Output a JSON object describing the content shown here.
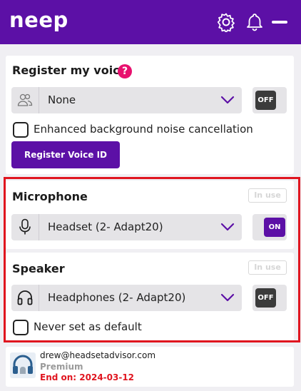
{
  "app": {
    "logo": "neep"
  },
  "header": {
    "settings_icon": "gear-icon",
    "notifications_icon": "bell-icon",
    "minimize_icon": "minus-icon"
  },
  "voice": {
    "title": "Register my voice",
    "help": "?",
    "select_value": "None",
    "toggle": "OFF",
    "noise_label": "Enhanced background noise cancellation",
    "register_button": "Register Voice ID"
  },
  "microphone": {
    "title": "Microphone",
    "badge": "In use",
    "select_value": "Headset (2- Adapt20)",
    "toggle": "ON"
  },
  "speaker": {
    "title": "Speaker",
    "badge": "In use",
    "select_value": "Headphones (2- Adapt20)",
    "toggle": "OFF",
    "default_label": "Never set as default"
  },
  "account": {
    "email": "drew@headsetadvisor.com",
    "plan": "Premium",
    "expiry": "End on: 2024-03-12"
  },
  "colors": {
    "brand": "#5c10a6",
    "help": "#e8106e",
    "highlight": "#e0151f"
  }
}
